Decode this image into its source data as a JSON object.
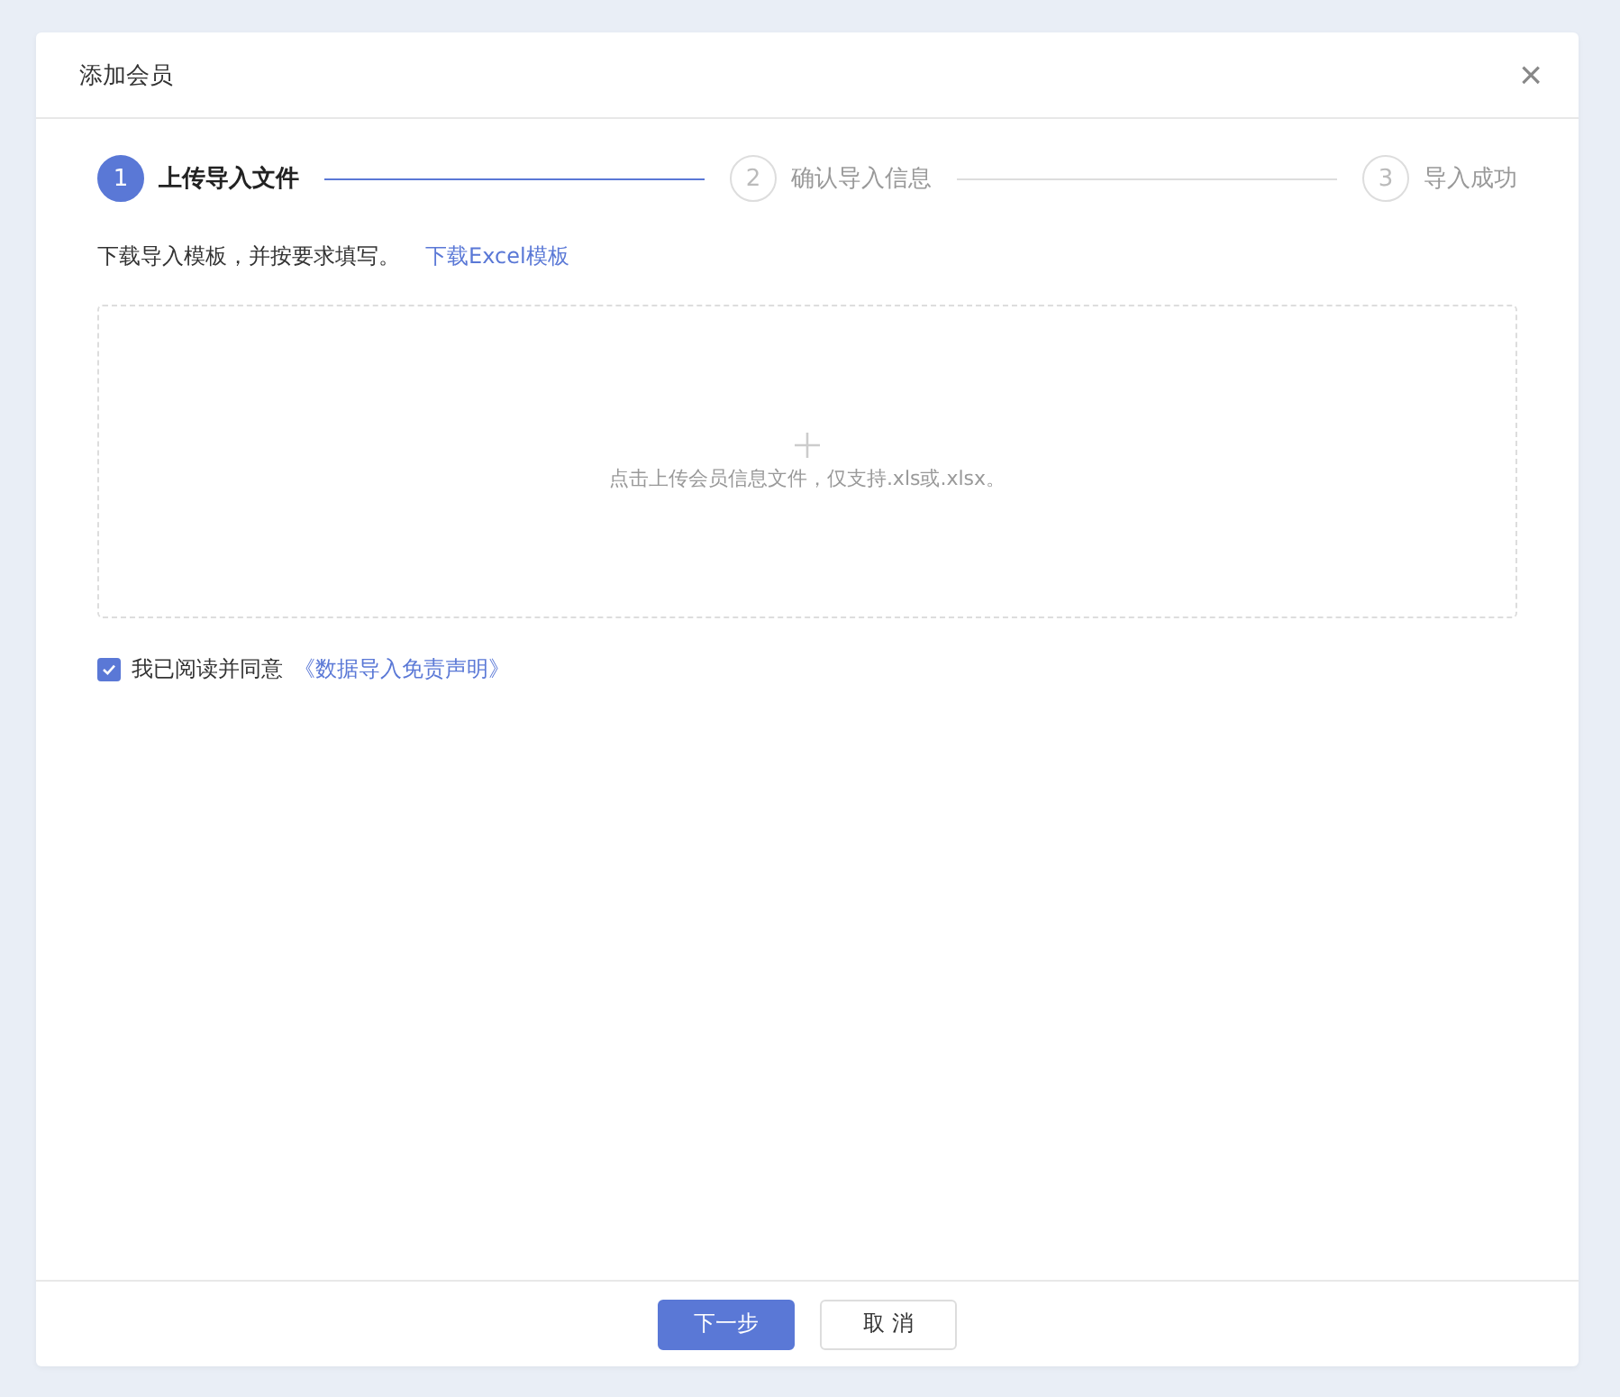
{
  "dialog": {
    "title": "添加会员",
    "close": "×"
  },
  "steps": [
    {
      "number": "1",
      "label": "上传导入文件",
      "selected": true
    },
    {
      "number": "2",
      "label": "确认导入信息",
      "selected": false
    },
    {
      "number": "3",
      "label": "导入成功",
      "selected": false
    }
  ],
  "template": {
    "text": "下载导入模板，并按要求填写。",
    "link": "下载Excel模板"
  },
  "upload": {
    "hint": "点击上传会员信息文件，仅支持.xls或.xlsx。"
  },
  "agreement": {
    "checked": true,
    "text": "我已阅读并同意",
    "link": "《数据导入免责声明》"
  },
  "buttons": [
    {
      "label": "下一步",
      "kind": "primary"
    },
    {
      "label": "取 消",
      "kind": "default"
    }
  ]
}
